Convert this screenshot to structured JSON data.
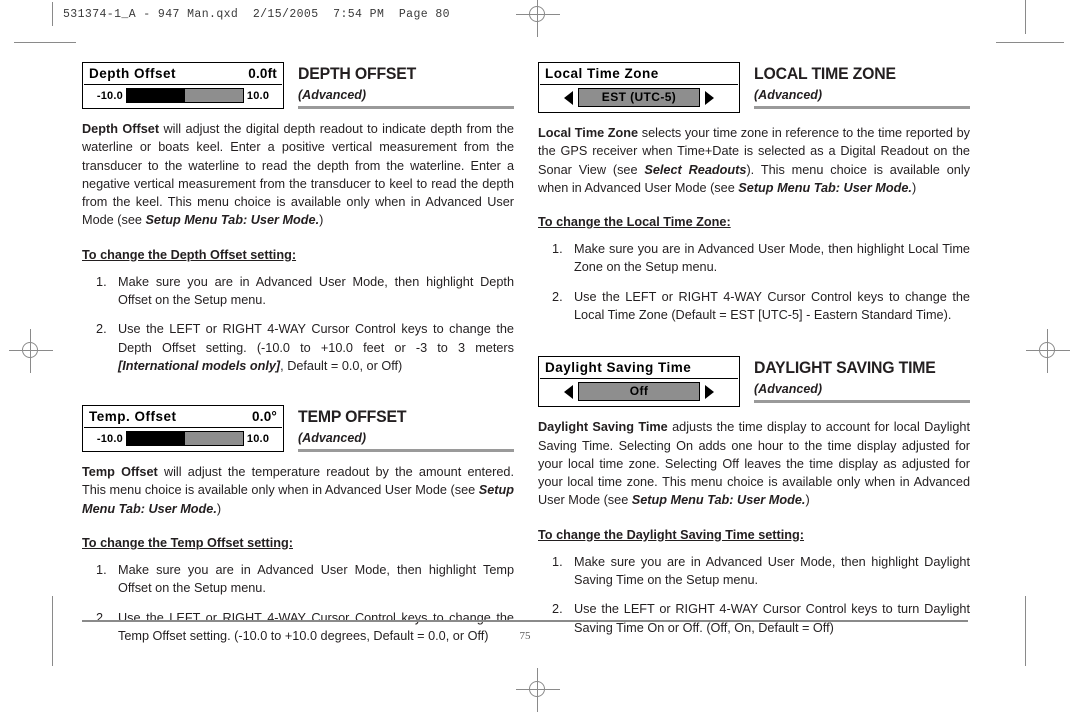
{
  "running_header": "531374-1_A - 947 Man.qxd  2/15/2005  7:54 PM  Page 80",
  "folio": "75",
  "sections": {
    "depth_offset": {
      "widget": {
        "title": "Depth Offset",
        "value": "0.0ft",
        "min_label": "-10.0",
        "max_label": "10.0",
        "fill_percent": 50
      },
      "heading": "DEPTH OFFSET",
      "subheading": "(Advanced)",
      "body_lead": "Depth Offset",
      "body_rest": " will adjust the digital depth readout to indicate depth from the waterline or boats keel. Enter a positive vertical measurement from the transducer to the waterline to read the depth from the waterline. Enter a negative vertical measurement from the transducer to keel to read the depth from the keel. This menu choice is available only when in Advanced User Mode (see ",
      "body_ref": "Setup Menu Tab: User Mode.",
      "body_tail": ")",
      "procedure_title": "To change the Depth Offset setting:",
      "steps": [
        {
          "text_before": "Make sure you are in Advanced User Mode, then highlight Depth Offset on the Setup menu.",
          "emphasis": "",
          "text_after": ""
        },
        {
          "text_before": "Use the LEFT or RIGHT 4-WAY Cursor Control keys to change the Depth Offset setting. (-10.0 to +10.0 feet or -3 to 3 meters ",
          "emphasis": "[International models only]",
          "text_after": ", Default = 0.0, or Off)"
        }
      ]
    },
    "temp_offset": {
      "widget": {
        "title": "Temp. Offset",
        "value": "0.0°",
        "min_label": "-10.0",
        "max_label": "10.0",
        "fill_percent": 50
      },
      "heading": "TEMP OFFSET",
      "subheading": "(Advanced)",
      "body_lead": "Temp Offset",
      "body_rest": " will adjust the temperature readout by the amount entered. This menu choice is available only when in Advanced User Mode (see ",
      "body_ref": "Setup Menu Tab: User Mode.",
      "body_tail": ")",
      "procedure_title": "To change the Temp Offset setting:",
      "steps": [
        {
          "text_before": "Make sure you are in Advanced User Mode, then highlight Temp Offset on the Setup menu.",
          "emphasis": "",
          "text_after": ""
        },
        {
          "text_before": "Use the LEFT or RIGHT 4-WAY Cursor Control keys to change the Temp Offset setting. (-10.0 to +10.0 degrees, Default = 0.0, or Off)",
          "emphasis": "",
          "text_after": ""
        }
      ]
    },
    "local_time_zone": {
      "widget": {
        "title": "Local Time Zone",
        "selected": "EST (UTC-5)",
        "left_arrow": "left-arrow-icon",
        "right_arrow": "right-arrow-icon"
      },
      "heading": "LOCAL TIME ZONE",
      "subheading": "(Advanced)",
      "body_lead": "Local Time Zone",
      "body_rest": " selects your time zone in reference to the time reported by the GPS receiver when Time+Date is selected as a Digital Readout on the Sonar View (see ",
      "body_ref": "Select Readouts",
      "body_rest2": "). This menu choice is available only when in Advanced User Mode (see ",
      "body_ref2": "Setup Menu Tab: User Mode.",
      "body_tail": ")",
      "procedure_title": "To change the Local Time Zone:",
      "steps": [
        {
          "text_before": "Make sure you are in Advanced User Mode, then highlight Local Time Zone on the Setup menu.",
          "emphasis": "",
          "text_after": ""
        },
        {
          "text_before": "Use the LEFT or RIGHT 4-WAY Cursor Control keys to change the Local Time Zone (Default = EST [UTC-5] - Eastern Standard Time).",
          "emphasis": "",
          "text_after": ""
        }
      ]
    },
    "daylight_saving_time": {
      "widget": {
        "title": "Daylight Saving Time",
        "selected": "Off",
        "left_arrow": "left-arrow-icon",
        "right_arrow": "right-arrow-icon"
      },
      "heading": "DAYLIGHT SAVING TIME",
      "subheading": "(Advanced)",
      "body_lead": "Daylight Saving Time",
      "body_rest": " adjusts the time display to account for local Daylight Saving Time. Selecting On adds one hour to the time display adjusted for your local time zone. Selecting Off leaves the time display as adjusted for your local time zone. This menu choice is available only when in Advanced User Mode (see ",
      "body_ref": "Setup Menu Tab: User Mode.",
      "body_tail": ")",
      "procedure_title": "To change the Daylight Saving Time setting:",
      "steps": [
        {
          "text_before": "Make sure you are in Advanced User Mode, then highlight Daylight Saving Time on the Setup menu.",
          "emphasis": "",
          "text_after": ""
        },
        {
          "text_before": "Use the LEFT or RIGHT 4-WAY Cursor Control keys to turn Daylight Saving Time On or Off. (Off, On, Default = Off)",
          "emphasis": "",
          "text_after": ""
        }
      ]
    }
  }
}
